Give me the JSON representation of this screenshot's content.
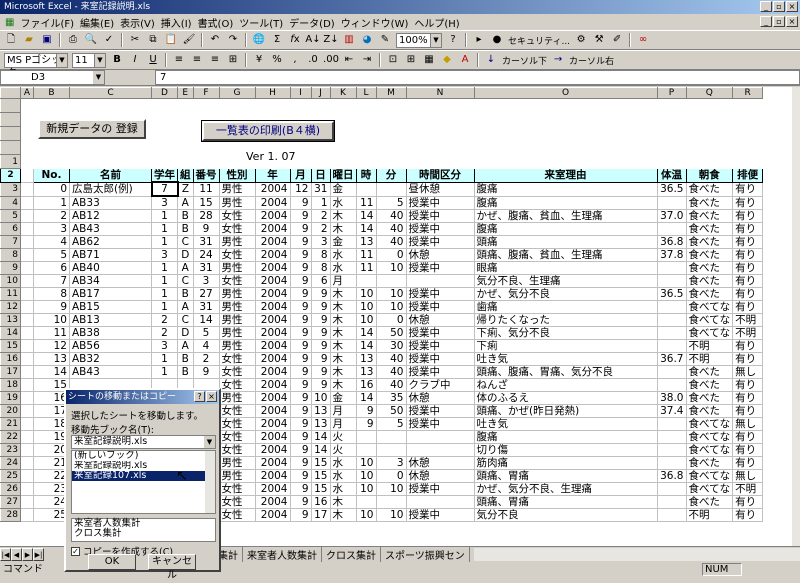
{
  "window": {
    "title": "Microsoft Excel - 来室記録説明.xls"
  },
  "menu": [
    "ファイル(F)",
    "編集(E)",
    "表示(V)",
    "挿入(I)",
    "書式(O)",
    "ツール(T)",
    "データ(D)",
    "ウィンドウ(W)",
    "ヘルプ(H)"
  ],
  "toolbar": {
    "zoom": "100%",
    "security": "セキュリティ...",
    "font": "MS Pゴシック",
    "size": "11",
    "cursor_down": "カーソル下",
    "cursor_right": "カーソル右"
  },
  "formula": {
    "cell": "D3",
    "value": "7"
  },
  "buttons": {
    "new_data": "新規データの 登録",
    "print_list": "一覧表の印刷(B４横)"
  },
  "version": "Ver 1. 07",
  "columns": [
    "A",
    "B",
    "C",
    "D",
    "E",
    "F",
    "G",
    "H",
    "I",
    "J",
    "K",
    "L",
    "M",
    "N",
    "O",
    "P",
    "Q",
    "R"
  ],
  "headers": [
    "No.",
    "名前",
    "学年",
    "組",
    "番号",
    "性別",
    "年",
    "月",
    "日",
    "曜日",
    "時",
    "分",
    "時間区分",
    "来室理由",
    "体温",
    "朝食",
    "排便"
  ],
  "rows": [
    [
      "0",
      "広島太郎(例)",
      "7",
      "Z",
      "11",
      "男性",
      "2004",
      "12",
      "31",
      "金",
      "",
      "",
      "昼休憩",
      "腹痛",
      "36.5",
      "食べた",
      "有り"
    ],
    [
      "1",
      "AB33",
      "3",
      "A",
      "15",
      "男性",
      "2004",
      "9",
      "1",
      "水",
      "11",
      "5",
      "授業中",
      "腹痛",
      "",
      "食べた",
      "有り"
    ],
    [
      "2",
      "AB12",
      "1",
      "B",
      "28",
      "女性",
      "2004",
      "9",
      "2",
      "木",
      "14",
      "40",
      "授業中",
      "かぜ、腹痛、貧血、生理痛",
      "37.0",
      "食べた",
      "有り"
    ],
    [
      "3",
      "AB43",
      "1",
      "B",
      "9",
      "女性",
      "2004",
      "9",
      "2",
      "木",
      "14",
      "40",
      "授業中",
      "腹痛",
      "",
      "食べた",
      "有り"
    ],
    [
      "4",
      "AB62",
      "1",
      "C",
      "31",
      "男性",
      "2004",
      "9",
      "3",
      "金",
      "13",
      "40",
      "授業中",
      "頭痛",
      "36.8",
      "食べた",
      "有り"
    ],
    [
      "5",
      "AB71",
      "3",
      "D",
      "24",
      "女性",
      "2004",
      "9",
      "8",
      "水",
      "11",
      "0",
      "休憩",
      "頭痛、腹痛、貧血、生理痛",
      "37.8",
      "食べた",
      "有り"
    ],
    [
      "6",
      "AB40",
      "1",
      "A",
      "31",
      "男性",
      "2004",
      "9",
      "8",
      "水",
      "11",
      "10",
      "授業中",
      "眼痛",
      "",
      "食べた",
      "有り"
    ],
    [
      "7",
      "AB34",
      "1",
      "C",
      "3",
      "女性",
      "2004",
      "9",
      "6",
      "月",
      "",
      "",
      "",
      "気分不良、生理痛",
      "",
      "食べた",
      "有り"
    ],
    [
      "8",
      "AB17",
      "1",
      "B",
      "27",
      "男性",
      "2004",
      "9",
      "9",
      "木",
      "10",
      "10",
      "授業中",
      "かぜ、気分不良",
      "36.5",
      "食べた",
      "有り"
    ],
    [
      "9",
      "AB15",
      "1",
      "A",
      "31",
      "男性",
      "2004",
      "9",
      "9",
      "木",
      "10",
      "10",
      "授業中",
      "歯痛",
      "",
      "食べてな",
      "有り"
    ],
    [
      "10",
      "AB13",
      "2",
      "C",
      "14",
      "男性",
      "2004",
      "9",
      "9",
      "木",
      "10",
      "0",
      "休憩",
      "帰りたくなった",
      "",
      "食べてな",
      "不明"
    ],
    [
      "11",
      "AB38",
      "2",
      "D",
      "5",
      "男性",
      "2004",
      "9",
      "9",
      "木",
      "14",
      "50",
      "授業中",
      "下痢、気分不良",
      "",
      "食べてな",
      "不明"
    ],
    [
      "12",
      "AB56",
      "3",
      "A",
      "4",
      "男性",
      "2004",
      "9",
      "9",
      "木",
      "14",
      "30",
      "授業中",
      "下痢",
      "",
      "不明",
      "有り"
    ],
    [
      "13",
      "AB32",
      "1",
      "B",
      "2",
      "女性",
      "2004",
      "9",
      "9",
      "木",
      "13",
      "40",
      "授業中",
      "吐き気",
      "36.7",
      "不明",
      "有り"
    ],
    [
      "14",
      "AB43",
      "1",
      "B",
      "9",
      "女性",
      "2004",
      "9",
      "9",
      "木",
      "13",
      "40",
      "授業中",
      "頭痛、腹痛、胃痛、気分不良",
      "",
      "食べた",
      "無し"
    ],
    [
      "15",
      "",
      "",
      "",
      "",
      "女性",
      "2004",
      "9",
      "9",
      "木",
      "16",
      "40",
      "クラブ中",
      "ねんざ",
      "",
      "食べた",
      "有り"
    ],
    [
      "16",
      "",
      "",
      "",
      "",
      "男性",
      "2004",
      "9",
      "10",
      "金",
      "14",
      "35",
      "休憩",
      "体のふるえ",
      "38.0",
      "食べた",
      "有り"
    ],
    [
      "17",
      "",
      "",
      "",
      "",
      "女性",
      "2004",
      "9",
      "13",
      "月",
      "9",
      "50",
      "授業中",
      "頭痛、かぜ(昨日発熱)",
      "37.4",
      "食べた",
      "有り"
    ],
    [
      "18",
      "",
      "",
      "",
      "",
      "女性",
      "2004",
      "9",
      "13",
      "月",
      "9",
      "5",
      "授業中",
      "吐き気",
      "",
      "食べてな",
      "無し"
    ],
    [
      "19",
      "",
      "",
      "",
      "",
      "女性",
      "2004",
      "9",
      "14",
      "火",
      "",
      "",
      "",
      "腹痛",
      "",
      "食べてな",
      "有り"
    ],
    [
      "20",
      "",
      "",
      "",
      "",
      "女性",
      "2004",
      "9",
      "14",
      "火",
      "",
      "",
      "",
      "切り傷",
      "",
      "食べてな",
      "有り"
    ],
    [
      "21",
      "",
      "",
      "",
      "",
      "男性",
      "2004",
      "9",
      "15",
      "水",
      "10",
      "3",
      "休憩",
      "筋肉痛",
      "",
      "食べた",
      "有り"
    ],
    [
      "22",
      "",
      "",
      "",
      "",
      "男性",
      "2004",
      "9",
      "15",
      "水",
      "10",
      "0",
      "休憩",
      "頭痛、胃痛",
      "36.8",
      "食べてな",
      "無し"
    ],
    [
      "23",
      "",
      "",
      "",
      "",
      "女性",
      "2004",
      "9",
      "15",
      "水",
      "10",
      "10",
      "授業中",
      "かぜ、気分不良、生理痛",
      "",
      "食べてな",
      "不明"
    ],
    [
      "24",
      "",
      "",
      "",
      "",
      "女性",
      "2004",
      "9",
      "16",
      "木",
      "",
      "",
      "",
      "頭痛、胃痛",
      "",
      "食べた",
      "有り"
    ],
    [
      "25",
      "",
      "",
      "",
      "",
      "女性",
      "2004",
      "9",
      "17",
      "木",
      "10",
      "10",
      "授業中",
      "気分不良",
      "",
      "不明",
      "有り"
    ]
  ],
  "sheettabs": [
    "集計",
    "来室者人数集計",
    "クロス集計",
    "スポーツ振興セン"
  ],
  "status": {
    "left": "コマンド",
    "num": "NUM"
  },
  "dialog": {
    "title": "シートの移動またはコピー",
    "desc": "選択したシートを移動します。",
    "book_label": "移動先ブック名(T):",
    "book_value": "来室記録説明.xls",
    "list": [
      "(新しいブック)",
      "来室記録説明.xls",
      "来室記録107.xls"
    ],
    "list2": [
      "来室者人数集計",
      "クロス集計"
    ],
    "copy_label": "コピーを作成する(C)",
    "ok": "OK",
    "cancel": "キャンセル"
  }
}
